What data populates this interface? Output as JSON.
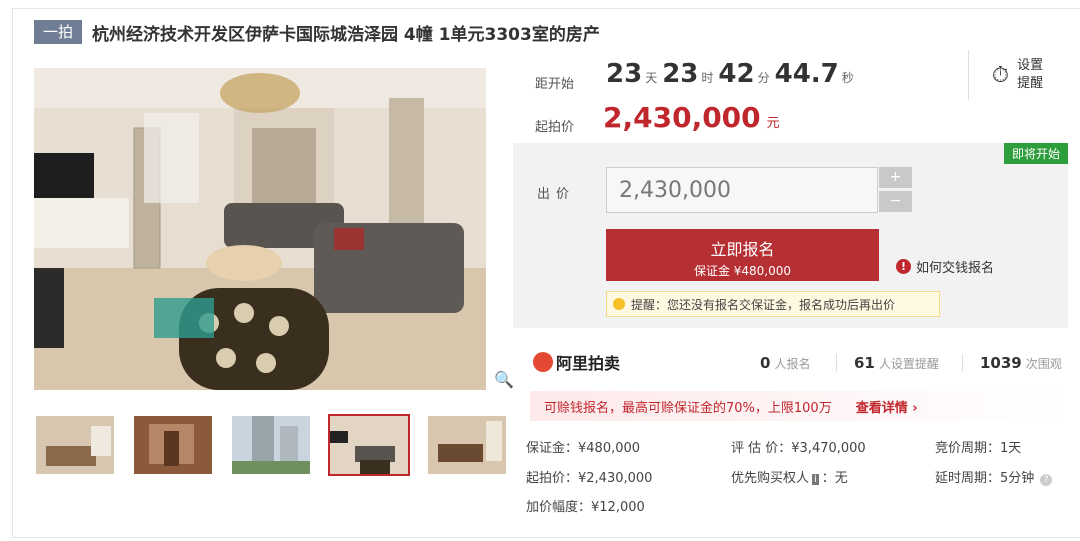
{
  "header": {
    "tag": "一拍",
    "title": "杭州经济技术开发区伊萨卡国际城浩泽园 4幢 1单元3303室的房产"
  },
  "countdown": {
    "label": "距开始",
    "days": "23",
    "days_unit": "天",
    "hours": "23",
    "hours_unit": "时",
    "minutes": "42",
    "minutes_unit": "分",
    "seconds": "44.7",
    "seconds_unit": "秒"
  },
  "reminder": {
    "label": "设置提醒"
  },
  "start": {
    "label": "起拍价",
    "price": "2,430,000",
    "unit": "元"
  },
  "bid": {
    "status_badge": "即将开始",
    "label": "出价",
    "input_value": "2,430,000",
    "plus": "+",
    "minus": "−",
    "register_label": "立即报名",
    "deposit_label": "保证金 ¥480,000",
    "howto_label": "如何交钱报名",
    "tip": "提醒：您还没有报名交保证金，报名成功后再出价"
  },
  "stats": {
    "brand": "阿里拍卖",
    "signups_num": "0",
    "signups_label": "人报名",
    "reminders_num": "61",
    "reminders_label": "人设置提醒",
    "views_num": "1039",
    "views_label": "次围观"
  },
  "loan": {
    "text": "可赊钱报名，最高可赊保证金的70%，上限100万",
    "more": "查看详情 ›"
  },
  "info": {
    "deposit": "保证金：¥480,000",
    "appraisal": "评 估 价：¥3,470,000",
    "period": "竞价周期：1天",
    "start_price": "起拍价：¥2,430,000",
    "priority_label": "优先购买权人",
    "priority_badge": "i",
    "priority_value": "：无",
    "delay": "延时周期：5分钟",
    "increment": "加价幅度：¥12,000"
  },
  "colors": {
    "accent": "#c0272d",
    "badge_green": "#2e9e3c",
    "tag": "#6f7d95"
  },
  "icons": [
    "alarm-clock-icon",
    "zoom-icon",
    "info-icon",
    "bulb-icon",
    "ali-logo-icon",
    "help-icon"
  ]
}
